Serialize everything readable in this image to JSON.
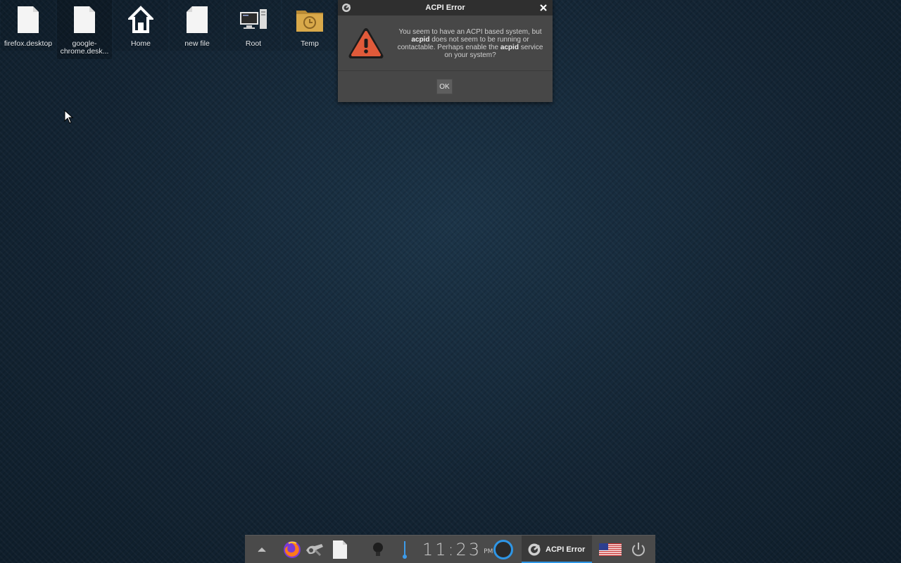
{
  "desktop": {
    "icons": [
      {
        "label": "firefox.desktop"
      },
      {
        "label": "google-chrome.desk..."
      },
      {
        "label": "Home"
      },
      {
        "label": "new file"
      },
      {
        "label": "Root"
      },
      {
        "label": "Temp"
      }
    ]
  },
  "dialog": {
    "title": "ACPI Error",
    "message_parts": {
      "p1": "You seem to have an ACPI based system, but ",
      "b1": "acpid",
      "p2": " does not seem to be running or contactable. Perhaps enable the ",
      "b2": "acpid",
      "p3": " service on your system?"
    },
    "ok_label": "OK"
  },
  "panel": {
    "clock": {
      "time": "11:23",
      "ampm": "PM"
    },
    "task": {
      "label": "ACPI Error"
    },
    "accent_color": "#2e96e6"
  },
  "colors": {
    "warning": "#e05a3a",
    "panel_bg": "#4a4a4a",
    "dialog_bg": "#474747"
  }
}
